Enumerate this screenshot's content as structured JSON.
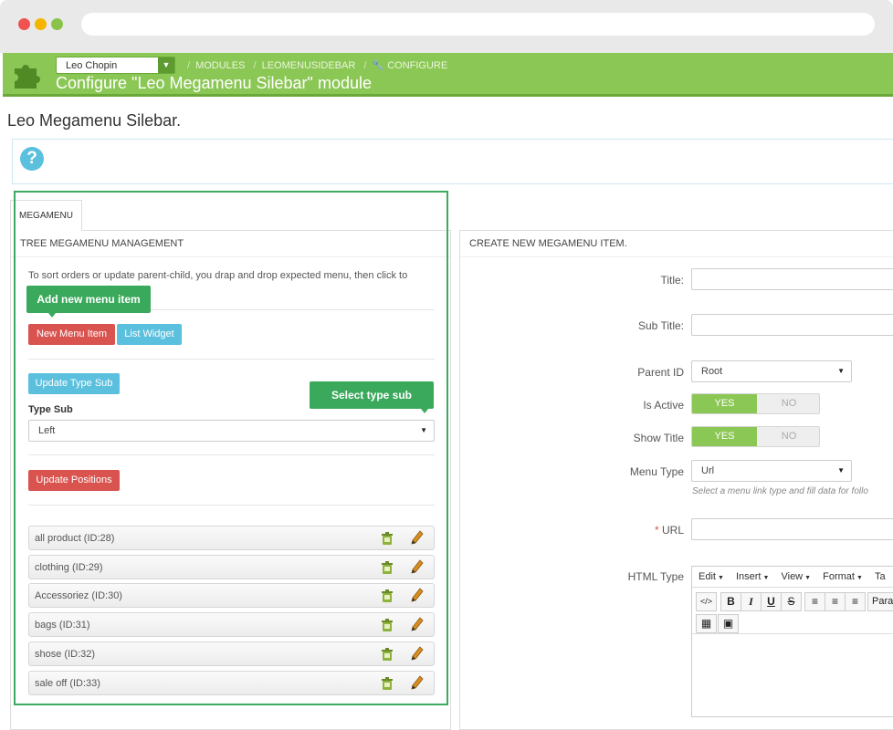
{
  "header": {
    "shop_name": "Leo Chopin",
    "breadcrumbs": [
      "MODULES",
      "LEOMENUSIDEBAR",
      "CONFIGURE"
    ],
    "page_title": "Configure \"Leo Megamenu Silebar\" module"
  },
  "main_title": "Leo Megamenu Silebar.",
  "tab_label": "MEGAMENU",
  "left_panel": {
    "heading": "TREE MEGAMENU MANAGEMENT",
    "instruction": "To sort orders or update parent-child, you drap and drop expected menu, then click to",
    "callout_add": "Add new menu item",
    "callout_type": "Select type sub",
    "new_menu_btn": "New Menu Item",
    "list_widget_btn": "List Widget",
    "update_type_btn": "Update Type Sub",
    "type_sub_label": "Type Sub",
    "type_sub_value": "Left",
    "update_positions_btn": "Update Positions",
    "items": [
      "all product (ID:28)",
      "clothing (ID:29)",
      "Accessoriez (ID:30)",
      "bags (ID:31)",
      "shose (ID:32)",
      "sale off (ID:33)"
    ]
  },
  "right_panel": {
    "heading": "CREATE NEW MEGAMENU ITEM.",
    "title_label": "Title:",
    "subtitle_label": "Sub Title:",
    "parent_label": "Parent ID",
    "parent_value": "Root",
    "active_label": "Is Active",
    "show_title_label": "Show Title",
    "yes": "YES",
    "no": "NO",
    "menu_type_label": "Menu Type",
    "menu_type_value": "Url",
    "menu_type_hint": "Select a menu link type and fill data for follo",
    "url_required": "*",
    "url_label": "URL",
    "html_type_label": "HTML Type",
    "editor_menu": [
      "Edit",
      "Insert",
      "View",
      "Format",
      "Ta"
    ],
    "paragraph_label": "Parag"
  }
}
